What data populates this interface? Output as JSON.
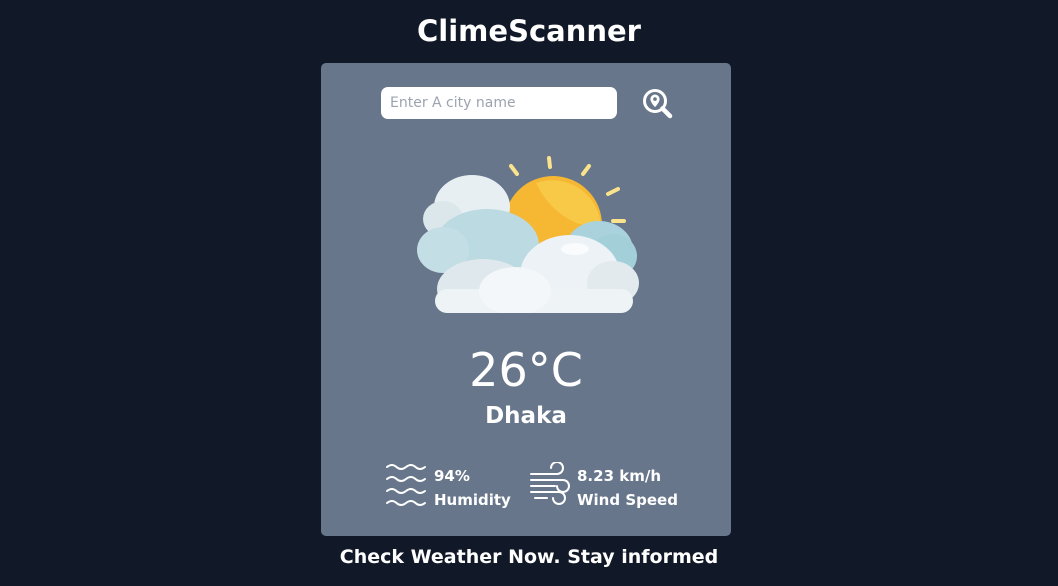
{
  "app": {
    "title": "ClimeScanner"
  },
  "search": {
    "placeholder": "Enter A city name",
    "value": ""
  },
  "icons": {
    "search": "search-location-icon",
    "weather": "partly-cloudy-icon",
    "humidity": "humidity-waves-icon",
    "wind": "wind-icon"
  },
  "weather": {
    "temperature": "26°C",
    "city": "Dhaka",
    "humidity_value": "94%",
    "humidity_label": "Humidity",
    "wind_value": "8.23 km/h",
    "wind_label": "Wind Speed"
  },
  "footer": {
    "tagline": "Check Weather Now. Stay informed"
  },
  "colors": {
    "background": "#111827",
    "card": "#67768b",
    "text": "#ffffff",
    "sun": "#f6b733"
  }
}
